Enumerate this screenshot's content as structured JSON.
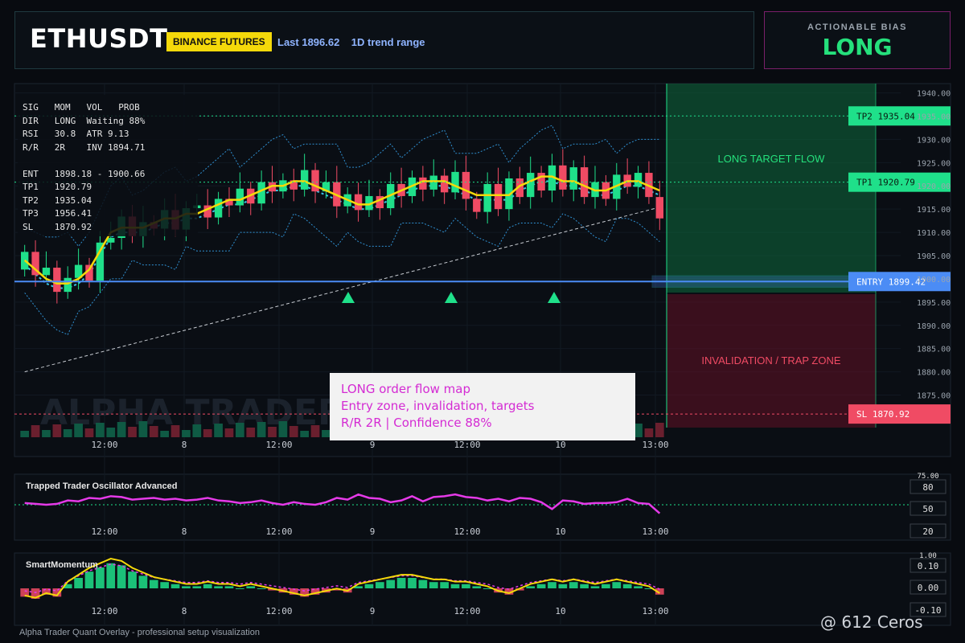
{
  "header": {
    "symbol": "ETHUSDT",
    "exchange": "BINANCE FUTURES",
    "last_label": "Last 1896.62",
    "range_label": "1D trend range"
  },
  "bias": {
    "title": "ACTIONABLE BIAS",
    "value": "LONG"
  },
  "info_rows": [
    "SIG   MOM   VOL   PROB",
    "DIR   LONG  Waiting 88%",
    "RSI   30.8  ATR 9.13",
    "R/R   2R    INV 1894.71",
    "",
    "ENT   1898.18 - 1900.66",
    "TP1   1920.79",
    "TP2   1935.04",
    "TP3   1956.41",
    "SL    1870.92"
  ],
  "note": {
    "line1": "LONG order flow map",
    "line2": "Entry zone, invalidation, targets",
    "line3": "R/R 2R | Confidence 88%"
  },
  "zones": {
    "long_label": "LONG TARGET FLOW",
    "trap_label": "INVALIDATION / TRAP ZONE"
  },
  "levels": {
    "tp2": {
      "label": "TP2 1935.04",
      "price": 1935.04
    },
    "tp1": {
      "label": "TP1 1920.79",
      "price": 1920.79
    },
    "entry": {
      "label": "ENTRY 1899.42",
      "price": 1899.42
    },
    "sl": {
      "label": "SL 1870.92",
      "price": 1870.92
    }
  },
  "colors": {
    "up": "#1fe08a",
    "down": "#f04b64",
    "ema": "#f5d90a",
    "entry": "#4b8cf5",
    "magenta": "#e53ae8"
  },
  "osc": {
    "title": "Trapped Trader Oscillator Advanced",
    "labels": [
      "75.00",
      "80",
      "50",
      "20"
    ]
  },
  "mom": {
    "title": "SmartMomentum",
    "labels": [
      "1.00",
      "0.10",
      "0.00",
      "-0.10"
    ]
  },
  "footer": "Alpha Trader Quant Overlay - professional setup visualization",
  "watermark": "@ 612 Ceros",
  "chart_data": {
    "type": "candlestick",
    "x_ticks": [
      "12:00",
      "8",
      "12:00",
      "9",
      "12:00",
      "10",
      "13:00"
    ],
    "y_ticks": [
      1875,
      1880,
      1885,
      1890,
      1895,
      1900,
      1905,
      1910,
      1915,
      1920,
      1925,
      1930,
      1935,
      1940
    ],
    "y_tick_labels": [
      "1875.00",
      "1880.00",
      "1885.00",
      "1890.00",
      "1895.00",
      "1900.00",
      "1905.00",
      "1910.00",
      "1915.00",
      "1920.00",
      "1925.00",
      "1930.00",
      "1935.00",
      "1940.00"
    ],
    "ylim": [
      1868,
      1942
    ],
    "ema_series": [
      1904,
      1902,
      1900,
      1899,
      1899,
      1900,
      1902,
      1906,
      1910,
      1911,
      1911,
      1911,
      1912,
      1913,
      1913,
      1914,
      1914,
      1915,
      1916,
      1917,
      1917,
      1918,
      1919,
      1920,
      1920,
      1921,
      1921,
      1920,
      1919,
      1918,
      1917,
      1916,
      1916,
      1917,
      1918,
      1919,
      1920,
      1921,
      1921,
      1921,
      1920,
      1919,
      1918,
      1918,
      1918,
      1918,
      1920,
      1921,
      1922,
      1922,
      1921,
      1921,
      1920,
      1919,
      1919,
      1920,
      1921,
      1921,
      1920,
      1919
    ],
    "signals_long": [
      1896,
      1896,
      1896
    ],
    "osc_series": [
      52,
      51,
      50,
      51,
      55,
      54,
      58,
      57,
      60,
      59,
      56,
      57,
      58,
      56,
      57,
      55,
      56,
      58,
      55,
      54,
      52,
      53,
      55,
      52,
      50,
      53,
      51,
      50,
      53,
      58,
      56,
      62,
      58,
      57,
      53,
      55,
      60,
      54,
      59,
      60,
      62,
      59,
      58,
      55,
      57,
      54,
      58,
      57,
      53,
      45,
      55,
      54,
      51,
      52,
      52,
      53,
      57,
      52,
      51,
      40
    ],
    "mom_series": [
      -0.04,
      -0.05,
      -0.03,
      -0.04,
      0.02,
      0.05,
      0.08,
      0.1,
      0.12,
      0.11,
      0.08,
      0.06,
      0.04,
      0.03,
      0.02,
      0.01,
      0.01,
      0.02,
      0.01,
      0.01,
      0.0,
      0.01,
      0.0,
      -0.01,
      -0.02,
      -0.03,
      -0.04,
      -0.03,
      -0.02,
      -0.01,
      -0.02,
      0.01,
      0.02,
      0.03,
      0.04,
      0.05,
      0.05,
      0.04,
      0.03,
      0.03,
      0.02,
      0.02,
      0.01,
      0.0,
      -0.02,
      -0.03,
      -0.01,
      0.01,
      0.02,
      0.03,
      0.02,
      0.03,
      0.02,
      0.01,
      0.02,
      0.03,
      0.02,
      0.01,
      0.0,
      -0.03
    ]
  }
}
